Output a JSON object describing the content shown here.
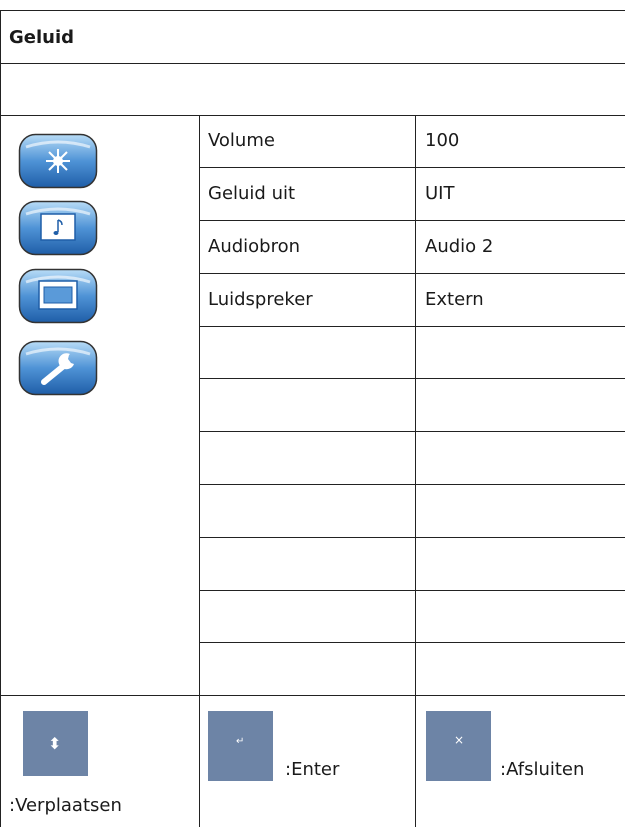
{
  "header": {
    "title": "Geluid"
  },
  "sidebar": {
    "icons": [
      {
        "name": "brightness-icon"
      },
      {
        "name": "music-note-icon"
      },
      {
        "name": "screen-icon"
      },
      {
        "name": "wrench-icon"
      }
    ]
  },
  "settings": {
    "rows": [
      {
        "label": "Volume",
        "value": "100"
      },
      {
        "label": "Geluid uit",
        "value": "UIT"
      },
      {
        "label": "Audiobron",
        "value": "Audio 2"
      },
      {
        "label": "Luidspreker",
        "value": "Extern"
      }
    ]
  },
  "footer": {
    "move": {
      "glyph": "⬍",
      "label": ":Verplaatsen"
    },
    "enter": {
      "glyph": "↵",
      "label": ":Enter"
    },
    "exit": {
      "glyph": "×",
      "label": ":Afsluiten"
    }
  },
  "colors": {
    "icon_blue": "#3d7fc4",
    "key_bg": "#6d84a6"
  }
}
